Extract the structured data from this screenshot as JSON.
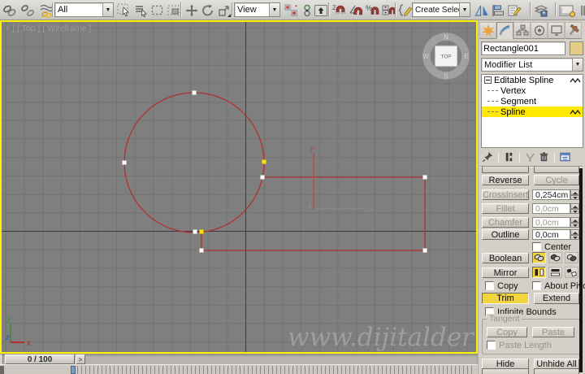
{
  "toolbar": {
    "selection_filter": "All",
    "coordinate_system": "View",
    "named_sets": "Create Selection Se",
    "snap_2d_label": "2",
    "percent_label": "%"
  },
  "viewport": {
    "label": "+ ] [ Top ] [ Wireframe ]",
    "watermark": "www.dijitalder",
    "viewcube": {
      "top": "TOP",
      "n": "N",
      "e": "E",
      "s": "S",
      "w": "W"
    },
    "tripod": {
      "x": "x",
      "y": "y",
      "z": "z"
    },
    "world_axis": {
      "x": "x",
      "y": "y",
      "z": "z"
    }
  },
  "timeline": {
    "frame": "0 / 100",
    "next": ">"
  },
  "panel": {
    "object_name": "Rectangle001",
    "modifier_list": "Modifier List",
    "stack": {
      "root": "Editable Spline",
      "items": [
        "Vertex",
        "Segment",
        "Spline"
      ]
    },
    "geometry": {
      "reverse": "Reverse",
      "cycle": "Cycle",
      "crossinsert": "CrossInsert",
      "crossinsert_value": "0,254cm",
      "fillet": "Fillet",
      "fillet_value": "0,0cm",
      "chamfer": "Chamfer",
      "chamfer_value": "0,0cm",
      "outline": "Outline",
      "outline_value": "0,0cm",
      "center": "Center",
      "boolean": "Boolean",
      "mirror": "Mirror",
      "copy": "Copy",
      "about_pivot": "About Pivot",
      "trim": "Trim",
      "extend": "Extend",
      "infinite_bounds": "Infinite Bounds",
      "tangent": "Tangent",
      "tangent_copy": "Copy",
      "tangent_paste": "Paste",
      "paste_length": "Paste Length",
      "hide": "Hide",
      "unhide_all": "Unhide All"
    },
    "colors": {
      "object_color": "#e3cd87",
      "active": "#f2d53e",
      "stack_selection": "#ffe900"
    }
  }
}
